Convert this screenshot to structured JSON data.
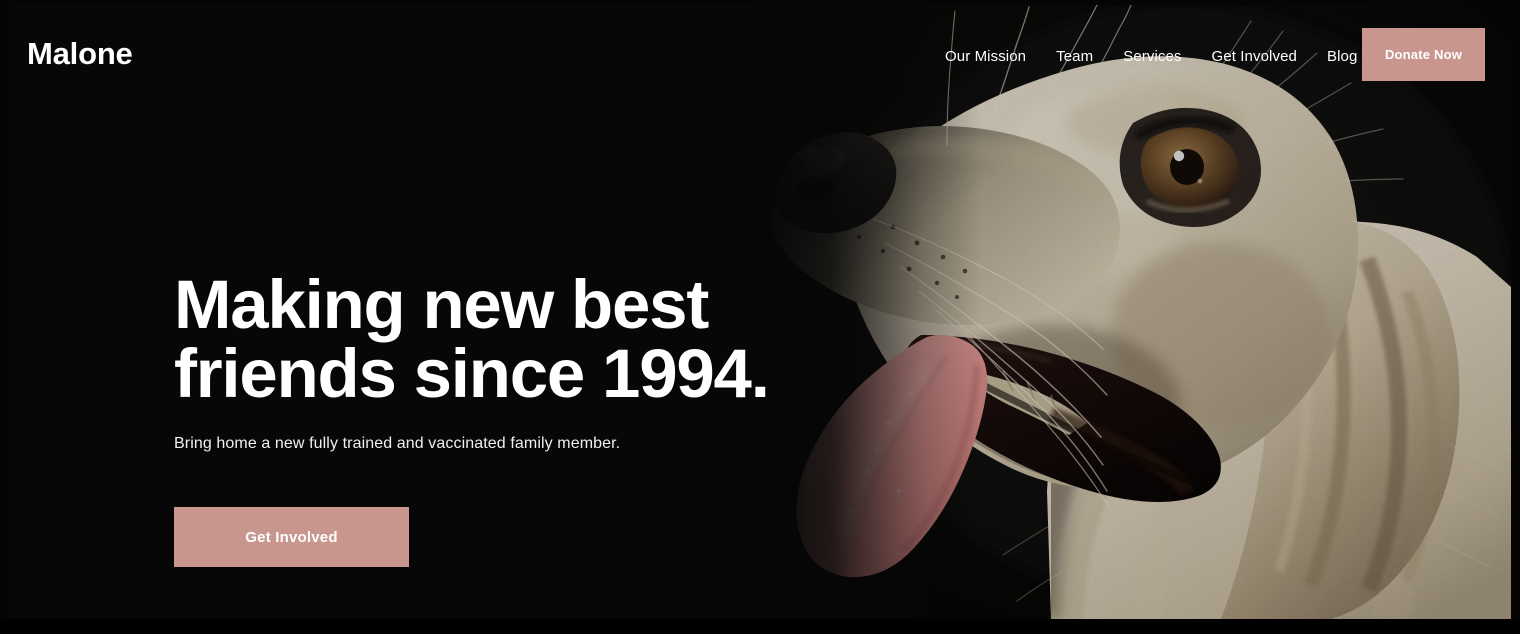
{
  "brand": {
    "logo_text": "Malone"
  },
  "colors": {
    "accent": "#c9968e",
    "background": "#000000",
    "text_primary": "#ffffff",
    "text_secondary": "#f2efed"
  },
  "nav": {
    "items": [
      {
        "label": "Our Mission"
      },
      {
        "label": "Team"
      },
      {
        "label": "Services"
      },
      {
        "label": "Get Involved"
      },
      {
        "label": "Blog"
      }
    ],
    "cta": {
      "label": "Donate Now"
    }
  },
  "hero": {
    "headline_line1": "Making new best",
    "headline_line2": "friends since 1994.",
    "subheadline": "Bring home a new fully trained and vaccinated family member.",
    "cta_label": "Get Involved",
    "image": {
      "name": "golden-retriever-dog-photo",
      "description": "Cream golden retriever in profile looking upward with tongue out on a black background"
    }
  }
}
